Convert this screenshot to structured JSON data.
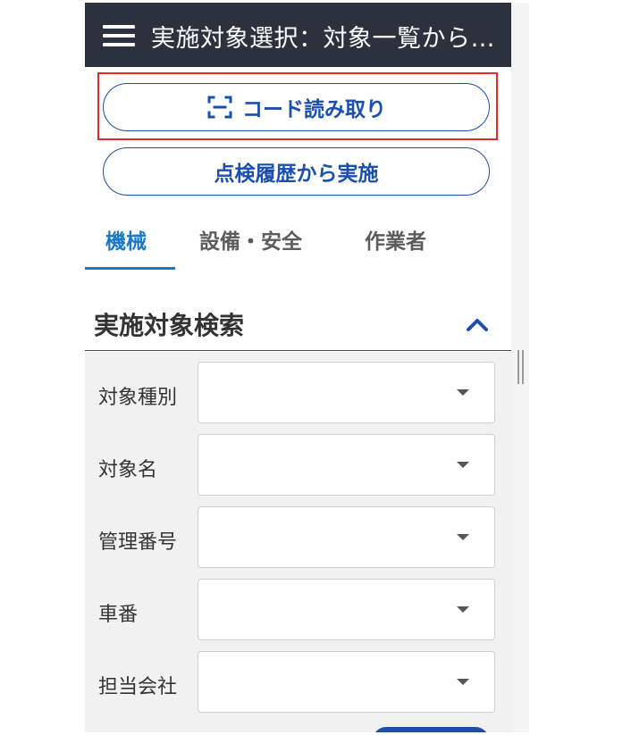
{
  "app_bar": {
    "title": "実施対象選択：対象一覧から選択"
  },
  "actions": {
    "scan_label": "コード読み取り",
    "history_label": "点検履歴から実施"
  },
  "tabs": [
    {
      "label": "機械",
      "active": true
    },
    {
      "label": "設備・安全",
      "active": false
    },
    {
      "label": "作業者",
      "active": false
    }
  ],
  "search": {
    "title": "実施対象検索",
    "fields": [
      {
        "label": "対象種別",
        "value": ""
      },
      {
        "label": "対象名",
        "value": ""
      },
      {
        "label": "管理番号",
        "value": ""
      },
      {
        "label": "車番",
        "value": ""
      },
      {
        "label": "担当会社",
        "value": ""
      }
    ]
  },
  "colors": {
    "app_bar": "#2b323d",
    "primary": "#1b4fae",
    "tab_active": "#1979c8",
    "highlight": "#e32b2b"
  },
  "icons": {
    "menu": "hamburger-icon",
    "scan": "scan-frame-icon",
    "collapse": "chevron-up-icon",
    "dropdown": "caret-down-icon"
  }
}
